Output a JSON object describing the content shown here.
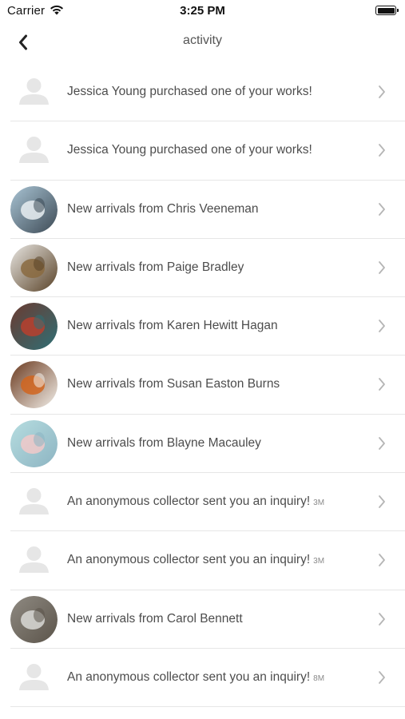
{
  "status_bar": {
    "carrier": "Carrier",
    "time": "3:25 PM"
  },
  "nav": {
    "title": "activity"
  },
  "colors": {
    "separator": "#e6e6e6",
    "placeholder_avatar": "#e8e8e8",
    "chevron": "#b5b5b5"
  },
  "rows": [
    {
      "text": "Jessica Young purchased one of your works!",
      "time": "",
      "avatar": "placeholder-user-icon"
    },
    {
      "text": "Jessica Young purchased one of your works!",
      "time": "",
      "avatar": "placeholder-user-icon"
    },
    {
      "text": "New arrivals from Chris Veeneman",
      "time": "",
      "avatar": "artwork-thumbnail"
    },
    {
      "text": "New arrivals from Paige Bradley",
      "time": "",
      "avatar": "artwork-thumbnail"
    },
    {
      "text": "New arrivals from Karen Hewitt Hagan",
      "time": "",
      "avatar": "artwork-thumbnail"
    },
    {
      "text": "New arrivals from Susan Easton Burns",
      "time": "",
      "avatar": "artwork-thumbnail"
    },
    {
      "text": "New arrivals from Blayne Macauley",
      "time": "",
      "avatar": "artwork-thumbnail"
    },
    {
      "text": "An anonymous collector sent you an inquiry!",
      "time": "3M",
      "avatar": "placeholder-user-icon"
    },
    {
      "text": "An anonymous collector sent you an inquiry!",
      "time": "3M",
      "avatar": "placeholder-user-icon"
    },
    {
      "text": "New arrivals from Carol Bennett",
      "time": "",
      "avatar": "artwork-thumbnail"
    },
    {
      "text": "An anonymous collector sent you an inquiry!",
      "time": "8M",
      "avatar": "placeholder-user-icon"
    }
  ]
}
